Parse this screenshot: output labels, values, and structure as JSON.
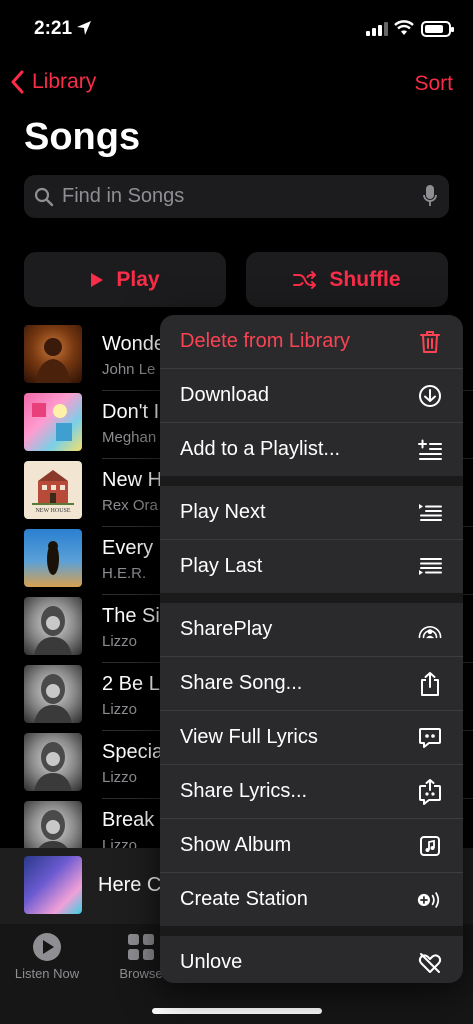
{
  "status_bar": {
    "time": "2:21"
  },
  "nav": {
    "back_label": "Library",
    "sort_label": "Sort"
  },
  "page": {
    "title": "Songs"
  },
  "search": {
    "placeholder": "Find in Songs"
  },
  "actions": {
    "play_label": "Play",
    "shuffle_label": "Shuffle"
  },
  "songs": [
    {
      "title": "Wonde",
      "artist": "John Le"
    },
    {
      "title": "Don't I",
      "artist": "Meghan"
    },
    {
      "title": "New H",
      "artist": "Rex Ora"
    },
    {
      "title": "Every",
      "artist": "H.E.R."
    },
    {
      "title": "The Si",
      "artist": "Lizzo"
    },
    {
      "title": "2 Be L",
      "artist": "Lizzo"
    },
    {
      "title": "Specia",
      "artist": "Lizzo"
    },
    {
      "title": "Break",
      "artist": "Lizzo"
    }
  ],
  "album_art": {
    "new_house_label": "NEW HOUSE"
  },
  "mini_player": {
    "title": "Here C"
  },
  "tabs": {
    "listen_now": "Listen Now",
    "browse": "Browse"
  },
  "context_menu": {
    "delete_from_library": "Delete from Library",
    "download": "Download",
    "add_to_playlist": "Add to a Playlist...",
    "play_next": "Play Next",
    "play_last": "Play Last",
    "shareplay": "SharePlay",
    "share_song": "Share Song...",
    "view_full_lyrics": "View Full Lyrics",
    "share_lyrics": "Share Lyrics...",
    "show_album": "Show Album",
    "create_station": "Create Station",
    "unlove": "Unlove"
  },
  "colors": {
    "accent": "#fa2d48",
    "background": "#000000",
    "menu_bg": "#2a2a2c"
  }
}
